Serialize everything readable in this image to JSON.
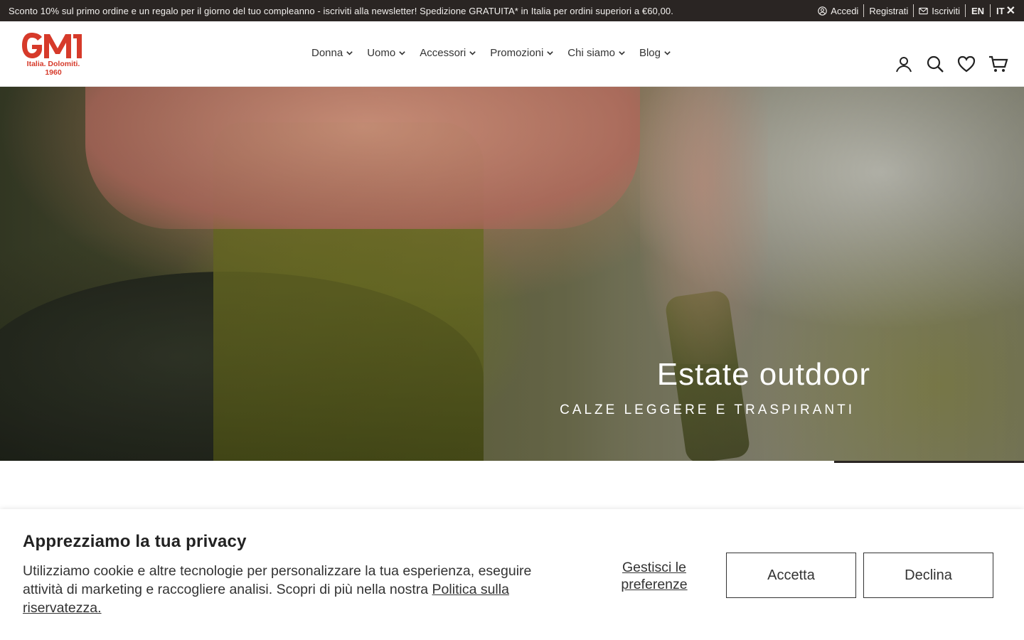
{
  "topbar": {
    "promo": "Sconto 10% sul primo ordine e un regalo per il giorno del tuo compleanno - iscriviti alla newsletter!  Spedizione GRATUITA* in Italia per ordini superiori a €60,00.",
    "login": "Accedi",
    "register": "Registrati",
    "subscribe": "Iscriviti",
    "lang_en": "EN",
    "lang_it": "IT",
    "close": "✕"
  },
  "logo": {
    "mark": "GM",
    "tagline_1": "Italia. Dolomiti.",
    "tagline_2": "1960",
    "color": "#d63a2a"
  },
  "nav": {
    "items": [
      "Donna",
      "Uomo",
      "Accessori",
      "Promozioni",
      "Chi siamo",
      "Blog"
    ]
  },
  "header_icons": [
    "account-icon",
    "search-icon",
    "wishlist-heart-icon",
    "cart-icon"
  ],
  "hero": {
    "title": "Estate outdoor",
    "subtitle": "CALZE LEGGERE E TRASPIRANTI"
  },
  "cookie": {
    "title": "Apprezziamo la tua privacy",
    "text": "Utilizziamo cookie e altre tecnologie per personalizzare la tua esperienza, eseguire attività di marketing e raccogliere analisi. Scopri di più nella nostra ",
    "policy_link": "Politica sulla riservatezza.",
    "preferences": "Gestisci le preferenze",
    "accept": "Accetta",
    "decline": "Declina"
  },
  "colors": {
    "topbar_bg": "#2a2523",
    "brand_red": "#d63a2a"
  }
}
